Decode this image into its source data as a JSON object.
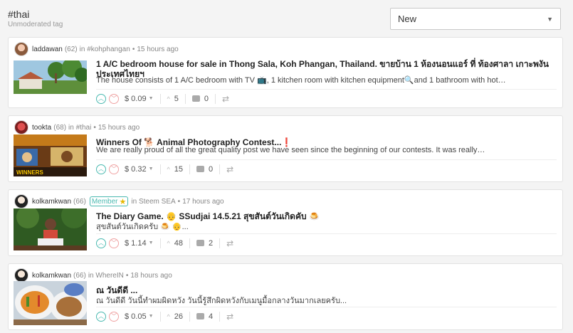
{
  "header": {
    "title": "#thai",
    "subtitle": "Unmoderated tag"
  },
  "sort": {
    "value": "New"
  },
  "posts": [
    {
      "author": "laddawan",
      "rep": "(62)",
      "in_label": "in",
      "community": "#kohphangan",
      "time": "15 hours ago",
      "title": "1 A/C bedroom house for sale in Thong Sala, Koh Phangan, Thailand. ขายบ้าน 1 ห้องนอนแอร์ ที่ ท้องศาลา เกาะพงันประเทศไทยฯ",
      "excerpt": "The house consists of 1 A/C bedroom with TV 📺, 1 kitchen room with kitchen equipment🔍and 1 bathroom with hot…",
      "payout": "$ 0.09",
      "votes": "5",
      "replies": "0"
    },
    {
      "author": "tookta",
      "rep": "(68)",
      "in_label": "in",
      "community": "#thai",
      "time": "15 hours ago",
      "title": "Winners Of 🐕 Animal Photography Contest...❗",
      "excerpt": "We are really proud of all the great quality post we have seen since the beginning of our contests. It was really…",
      "payout": "$ 0.32",
      "votes": "15",
      "replies": "0"
    },
    {
      "author": "kolkamkwan",
      "rep": "(66)",
      "badge": "Member",
      "in_label": "in",
      "community": "Steem SEA",
      "time": "17 hours ago",
      "title": "The Diary Game. 👴 SSudjai 14.5.21 สุขสันต์วันเกิดคับ 🍮",
      "excerpt": "สุขสันต์วันเกิดครับ 🍮 👴...",
      "payout": "$ 1.14",
      "votes": "48",
      "replies": "2"
    },
    {
      "author": "kolkamkwan",
      "rep": "(66)",
      "in_label": "in",
      "community": "WhereIN",
      "time": "18 hours ago",
      "title": "ณ วันดีดี ...",
      "excerpt": "ณ วันดีดี วันนี้ทำผมผิดหวัง วันนี้รู้สึกผิดหวังกับเมนูมื้อกลางวันมากเลยครับ...",
      "payout": "$ 0.05",
      "votes": "26",
      "replies": "4"
    }
  ]
}
